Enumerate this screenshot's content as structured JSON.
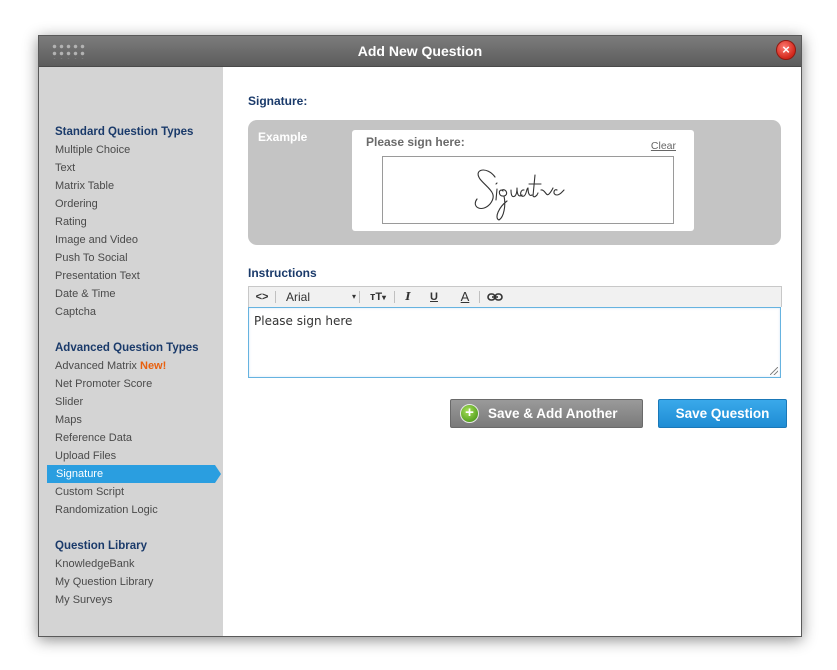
{
  "dialog": {
    "title": "Add New Question",
    "close_icon": "×"
  },
  "sidebar": {
    "groups": [
      {
        "heading": "Standard Question Types",
        "items": [
          "Multiple Choice",
          "Text",
          "Matrix Table",
          "Ordering",
          "Rating",
          "Image and Video",
          "Push To Social",
          "Presentation Text",
          "Date & Time",
          "Captcha"
        ]
      },
      {
        "heading": "Advanced Question Types",
        "items": [
          "Advanced Matrix",
          "Net Promoter Score",
          "Slider",
          "Maps",
          "Reference Data",
          "Upload Files",
          "Signature",
          "Custom Script",
          "Randomization Logic"
        ],
        "new_badge": "New!",
        "active_item": "Signature"
      },
      {
        "heading": "Question Library",
        "items": [
          "KnowledgeBank",
          "My Question Library",
          "My Surveys"
        ]
      }
    ]
  },
  "main": {
    "section_title": "Signature:",
    "example": {
      "label": "Example",
      "prompt": "Please sign here:",
      "clear_link": "Clear"
    },
    "instructions": {
      "label": "Instructions",
      "toolbar": {
        "source_icon": "<>",
        "font_name": "Arial",
        "font_size_icon": "тT",
        "italic_icon": "I",
        "underline_icon": "U",
        "font_color_icon": "A",
        "link_icon": "link-icon"
      },
      "text": "Please sign here"
    },
    "buttons": {
      "save_add_another": "Save & Add Another",
      "save_question": "Save Question"
    }
  },
  "colors": {
    "accent": "#2a9ee0",
    "new_badge": "#e8600e",
    "heading": "#1a3a6a",
    "titlebar": "#6b6b6b"
  }
}
